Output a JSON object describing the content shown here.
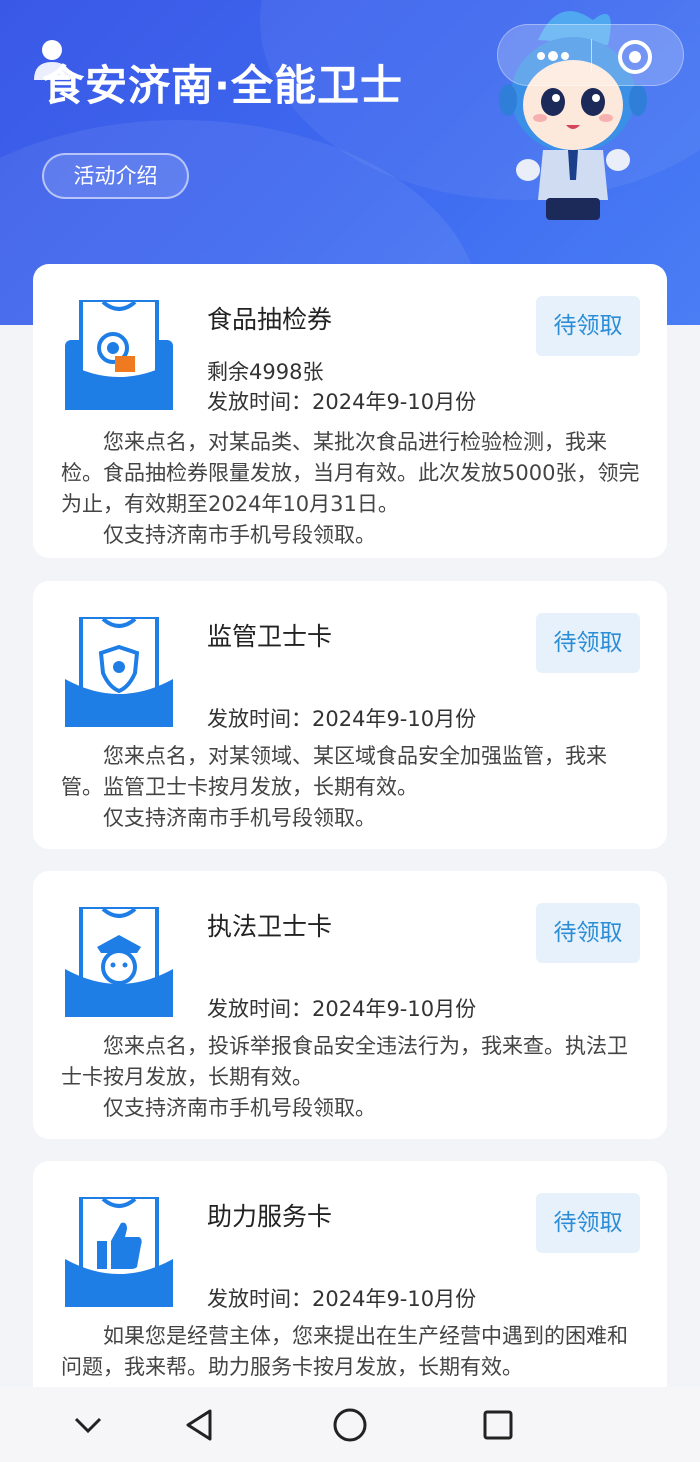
{
  "header": {
    "title": "食安济南·全能卫士",
    "intro_button": "活动介绍"
  },
  "icons": {
    "user": "person-icon",
    "more": "more-dots-icon",
    "close": "close-circle-icon",
    "nav_down": "chevron-down-icon",
    "nav_back": "back-triangle-icon",
    "nav_home": "home-circle-icon",
    "nav_recent": "recent-square-icon"
  },
  "colors": {
    "banner": "#3e6af0",
    "claim_bg": "#e6f1fb",
    "claim_text": "#2b8dd6",
    "icon_blue": "#1f7ee6"
  },
  "cards": [
    {
      "name": "食品抽检券",
      "claim": "待领取",
      "remaining": "剩余4998张",
      "time": "发放时间：2024年9-10月份",
      "desc": [
        "您来点名，对某品类、某批次食品进行检验检测，我来检。食品抽检券限量发放，当月有效。此次发放5000张，领完为止，有效期至2024年10月31日。",
        "仅支持济南市手机号段领取。"
      ]
    },
    {
      "name": "监管卫士卡",
      "claim": "待领取",
      "time": "发放时间：2024年9-10月份",
      "desc": [
        "您来点名，对某领域、某区域食品安全加强监管，我来管。监管卫士卡按月发放，长期有效。",
        "仅支持济南市手机号段领取。"
      ]
    },
    {
      "name": "执法卫士卡",
      "claim": "待领取",
      "time": "发放时间：2024年9-10月份",
      "desc": [
        "您来点名，投诉举报食品安全违法行为，我来查。执法卫士卡按月发放，长期有效。",
        "仅支持济南市手机号段领取。"
      ]
    },
    {
      "name": "助力服务卡",
      "claim": "待领取",
      "time": "发放时间：2024年9-10月份",
      "desc": [
        "如果您是经营主体，您来提出在生产经营中遇到的困难和问题，我来帮。助力服务卡按月发放，长期有效。"
      ]
    }
  ]
}
